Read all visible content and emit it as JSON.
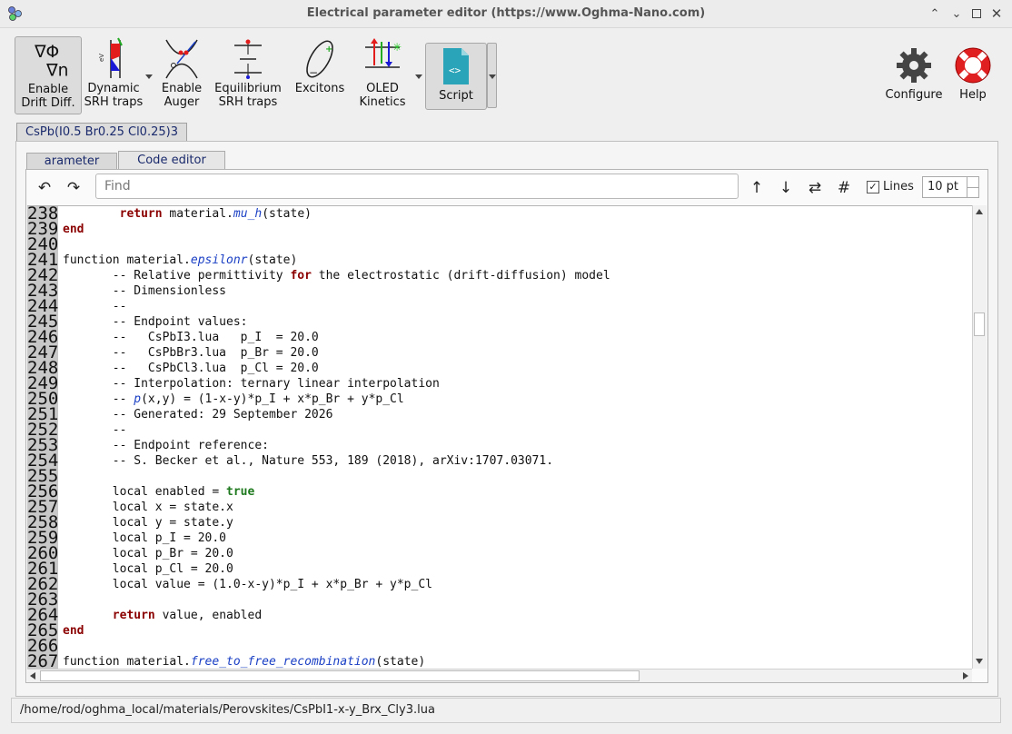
{
  "window": {
    "title": "Electrical parameter editor (https://www.Oghma-Nano.com)",
    "controls": [
      "minimize",
      "restore",
      "maximize",
      "close"
    ]
  },
  "toolbar": {
    "drift": "Enable\nDrift Diff.",
    "dynamic_srh": "Dynamic\nSRH traps",
    "auger": "Enable\nAuger",
    "equilibrium_srh": "Equilibrium\nSRH traps",
    "excitons": "Excitons",
    "oled": "OLED\nKinetics",
    "script": "Script",
    "configure": "Configure",
    "help": "Help"
  },
  "icons": {
    "drift": "nabla-phi-nabla-n-icon",
    "dynamic_srh": "srh-trap-icon",
    "auger": "auger-icon",
    "equilibrium_srh": "equilibrium-trap-icon",
    "excitons": "exciton-icon",
    "oled": "oled-kinetics-icon",
    "script": "script-file-icon",
    "configure": "gear-icon",
    "help": "lifebuoy-icon"
  },
  "material_tab": "CsPb(I0.5 Br0.25 Cl0.25)3",
  "subtabs": {
    "parameter": "arameter",
    "code_editor": "Code editor"
  },
  "findbar": {
    "undo": "↶",
    "redo": "↷",
    "placeholder": "Find",
    "up": "↑",
    "down": "↓",
    "replace": "⇄",
    "hash": "#",
    "lines_label": "Lines",
    "lines_checked": true,
    "font_size": "10 pt"
  },
  "code": {
    "line_numbers": [
      "238",
      "239",
      "240",
      "241",
      "242",
      "243",
      "244",
      "245",
      "246",
      "247",
      "248",
      "249",
      "250",
      "251",
      "252",
      "253",
      "254",
      "255",
      "256",
      "257",
      "258",
      "259",
      "260",
      "261",
      "262",
      "263",
      "264",
      "265",
      "266",
      "267"
    ],
    "lines": [
      [
        [
          "        ",
          ""
        ],
        [
          "return",
          "kw"
        ],
        [
          " material.",
          ""
        ],
        [
          "mu_h",
          "fn"
        ],
        [
          "(state)",
          ""
        ]
      ],
      [
        [
          "end",
          "kw"
        ]
      ],
      [],
      [
        [
          "function material.",
          ""
        ],
        [
          "epsilonr",
          "fn"
        ],
        [
          "(state)",
          ""
        ]
      ],
      [
        [
          "       -- Relative permittivity ",
          ""
        ],
        [
          "for",
          "kw"
        ],
        [
          " the electrostatic (drift-diffusion) model",
          ""
        ]
      ],
      [
        [
          "       -- Dimensionless",
          ""
        ]
      ],
      [
        [
          "       --",
          ""
        ]
      ],
      [
        [
          "       -- Endpoint values:",
          ""
        ]
      ],
      [
        [
          "       --   CsPbI3.lua   p_I  = 20.0",
          ""
        ]
      ],
      [
        [
          "       --   CsPbBr3.lua  p_Br = 20.0",
          ""
        ]
      ],
      [
        [
          "       --   CsPbCl3.lua  p_Cl = 20.0",
          ""
        ]
      ],
      [
        [
          "       -- Interpolation: ternary linear interpolation",
          ""
        ]
      ],
      [
        [
          "       -- ",
          ""
        ],
        [
          "p",
          "fn"
        ],
        [
          "(x,y) = (1-x-y)*p_I + x*p_Br + y*p_Cl",
          ""
        ]
      ],
      [
        [
          "       -- Generated: 29 September 2026",
          ""
        ]
      ],
      [
        [
          "       --",
          ""
        ]
      ],
      [
        [
          "       -- Endpoint reference:",
          ""
        ]
      ],
      [
        [
          "       -- S. Becker et al., Nature 553, 189 (2018), arXiv:1707.03071.",
          ""
        ]
      ],
      [],
      [
        [
          "       local enabled = ",
          ""
        ],
        [
          "true",
          "kw-bool"
        ]
      ],
      [
        [
          "       local x = state.x",
          ""
        ]
      ],
      [
        [
          "       local y = state.y",
          ""
        ]
      ],
      [
        [
          "       local p_I = 20.0",
          ""
        ]
      ],
      [
        [
          "       local p_Br = 20.0",
          ""
        ]
      ],
      [
        [
          "       local p_Cl = 20.0",
          ""
        ]
      ],
      [
        [
          "       local value = (1.0-x-y)*p_I + x*p_Br + y*p_Cl",
          ""
        ]
      ],
      [],
      [
        [
          "       ",
          ""
        ],
        [
          "return",
          "kw"
        ],
        [
          " value, enabled",
          ""
        ]
      ],
      [
        [
          "end",
          "kw"
        ]
      ],
      [],
      [
        [
          "function material.",
          ""
        ],
        [
          "free_to_free_recombination",
          "fn"
        ],
        [
          "(state)",
          ""
        ]
      ]
    ]
  },
  "status": {
    "path": "/home/rod/oghma_local/materials/Perovskites/CsPbI1-x-y_Brx_Cly3.lua"
  }
}
